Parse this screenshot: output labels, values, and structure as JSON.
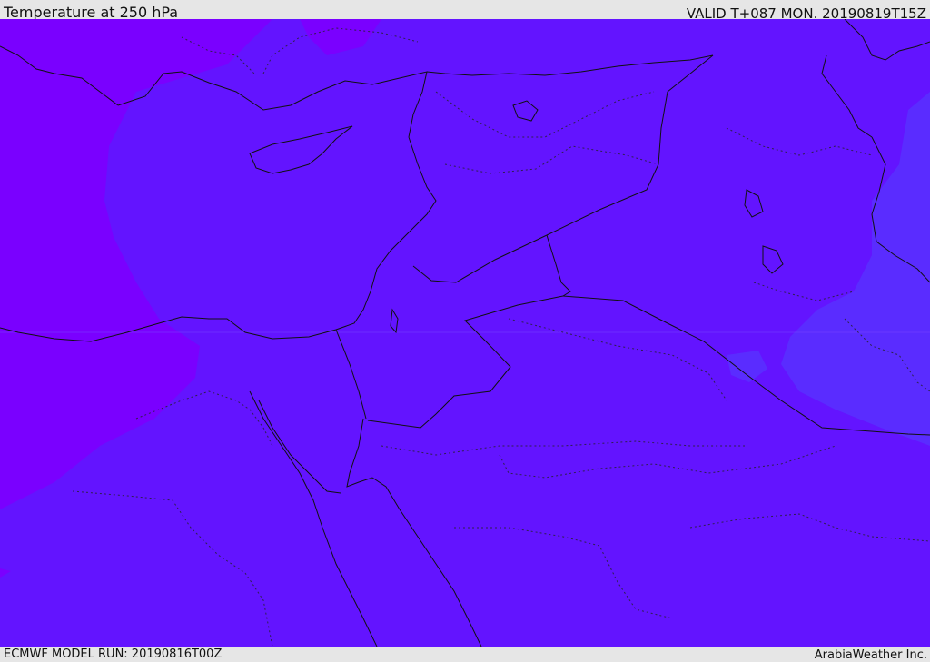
{
  "header": {
    "title": "Temperature at 250 hPa",
    "valid": "VALID T+087 MON. 20190819T15Z"
  },
  "footer": {
    "model_run": "ECMWF MODEL RUN: 20190816T00Z",
    "credit": "ArabiaWeather Inc."
  },
  "colors": {
    "background": "#e6e6e6",
    "temp_band_cold": "#7a00ff",
    "temp_band_mid": "#6314ff",
    "temp_band_warm": "#5a2cff",
    "coastline": "#111111"
  }
}
